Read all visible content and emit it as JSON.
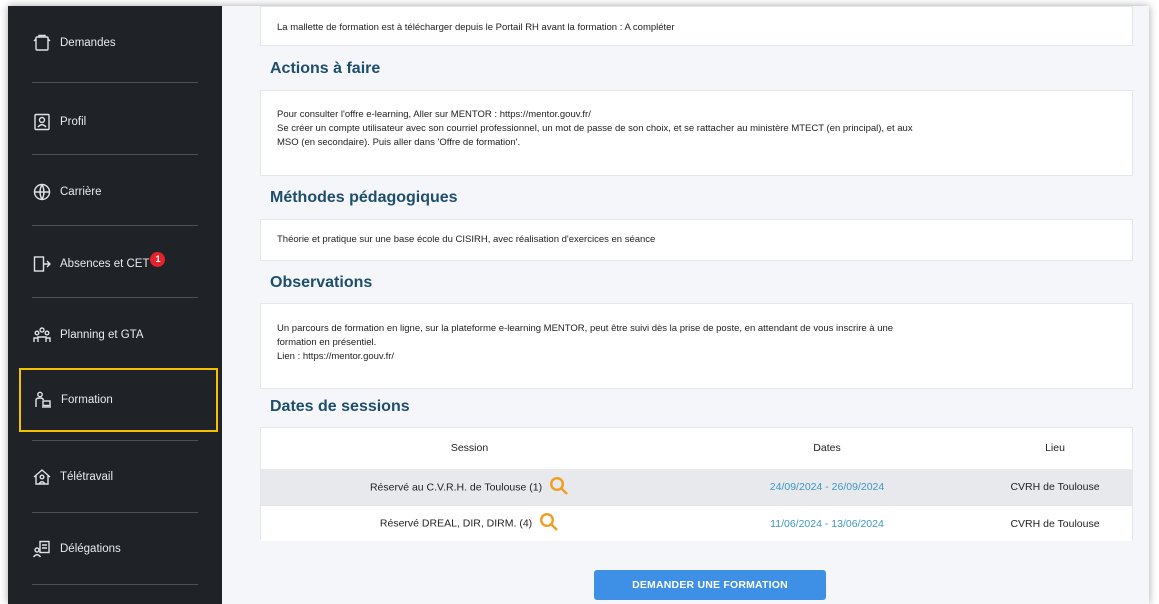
{
  "sidebar": {
    "items": [
      {
        "label": "Demandes",
        "icon": "clipboard-icon"
      },
      {
        "label": "Profil",
        "icon": "id-card-icon"
      },
      {
        "label": "Carrière",
        "icon": "globe-icon"
      },
      {
        "label": "Absences et CET",
        "icon": "door-exit-icon",
        "badge": "1"
      },
      {
        "label": "Planning et GTA",
        "icon": "people-group-icon"
      },
      {
        "label": "Formation",
        "icon": "person-laptop-icon",
        "active": true
      },
      {
        "label": "Télétravail",
        "icon": "home-person-icon"
      },
      {
        "label": "Délégations",
        "icon": "delegation-icon"
      }
    ]
  },
  "main": {
    "top_card_text": "La mallette de formation est à télécharger depuis le Portail RH avant la formation : A compléter",
    "actions": {
      "title": "Actions à faire",
      "line1": "Pour consulter l'offre e-learning, Aller sur MENTOR : https://mentor.gouv.fr/",
      "line2": "Se créer un compte utilisateur avec son courriel professionnel, un mot de passe de son choix, et se rattacher au ministère MTECT (en principal), et aux",
      "line3": "MSO (en secondaire). Puis aller dans 'Offre de formation'."
    },
    "methodes": {
      "title": "Méthodes pédagogiques",
      "text": "Théorie et pratique sur une base école du CISIRH, avec réalisation d'exercices en séance"
    },
    "observations": {
      "title": "Observations",
      "line1": "Un parcours de formation en ligne, sur la plateforme e-learning MENTOR, peut être suivi dès la prise de poste, en attendant de vous inscrire à une",
      "line2": "formation en présentiel.",
      "line3": "Lien : https://mentor.gouv.fr/"
    },
    "sessions": {
      "title": "Dates de sessions",
      "headers": {
        "session": "Session",
        "dates": "Dates",
        "lieu": "Lieu"
      },
      "rows": [
        {
          "session": "Réservé au C.V.R.H. de Toulouse (1)",
          "dates": "24/09/2024 - 26/09/2024",
          "lieu": "CVRH de Toulouse"
        },
        {
          "session": "Réservé DREAL, DIR, DIRM. (4)",
          "dates": "11/06/2024 - 13/06/2024",
          "lieu": "CVRH de Toulouse"
        }
      ]
    },
    "request_button": "DEMANDER UNE FORMATION"
  },
  "colors": {
    "sidebar_bg": "#1f2327",
    "active_outline": "#f2c200",
    "section_title": "#1e4e6b",
    "date_link": "#3d97c2",
    "search_icon": "#f29d21",
    "button_bg": "#3e8fe6",
    "badge": "#e5232b"
  }
}
